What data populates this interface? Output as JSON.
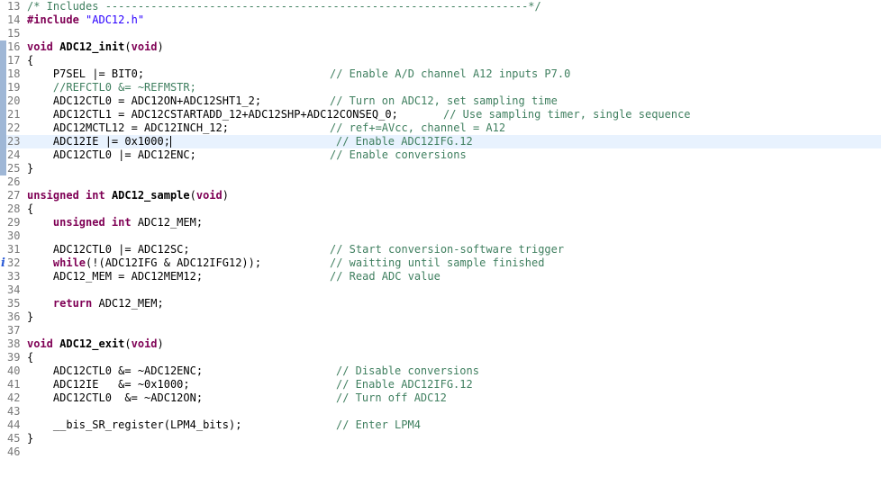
{
  "editor": {
    "current_line": "23",
    "lines": [
      {
        "num": "13",
        "c1": "/* Includes -----------------------------------------------------------------*/"
      },
      {
        "num": "14",
        "kw": "#include",
        "str": "\"ADC12.h\""
      },
      {
        "num": "15"
      },
      {
        "num": "16",
        "kw": "void",
        "fn": "ADC12_init",
        "open": "(",
        "kw2": "void",
        "close": ")"
      },
      {
        "num": "17",
        "text": "{"
      },
      {
        "num": "18",
        "code": "    P7SEL |= BIT0;",
        "comment": "// Enable A/D channel A12 inputs P7.0"
      },
      {
        "num": "19",
        "commentcode": "    //REFCTL0 &= ~REFMSTR;"
      },
      {
        "num": "20",
        "code": "    ADC12CTL0 = ADC12ON+ADC12SHT1_2;",
        "comment": "// Turn on ADC12, set sampling time"
      },
      {
        "num": "21",
        "code": "    ADC12CTL1 = ADC12CSTARTADD_12+ADC12SHP+ADC12CONSEQ_0;",
        "comment": "// Use sampling timer, single sequence"
      },
      {
        "num": "22",
        "code": "    ADC12MCTL12 = ADC12INCH_12;",
        "comment": "// ref+=AVcc, channel = A12"
      },
      {
        "num": "23",
        "code": "    ADC12IE |= 0x1000;",
        "comment": "// Enable ADC12IFG.12"
      },
      {
        "num": "24",
        "code": "    ADC12CTL0 |= ADC12ENC;",
        "comment": "// Enable conversions"
      },
      {
        "num": "25",
        "text": "}"
      },
      {
        "num": "26"
      },
      {
        "num": "27",
        "kw": "unsigned int",
        "fn": "ADC12_sample",
        "open": "(",
        "kw2": "void",
        "close": ")"
      },
      {
        "num": "28",
        "text": "{"
      },
      {
        "num": "29",
        "kw_indent": "    unsigned int",
        "rest": " ADC12_MEM;"
      },
      {
        "num": "30"
      },
      {
        "num": "31",
        "code": "    ADC12CTL0 |= ADC12SC;",
        "comment": "// Start conversion-software trigger"
      },
      {
        "num": "32",
        "kw_indent": "    while",
        "rest": "(!(ADC12IFG & ADC12IFG12));",
        "comment": "// waitting until sample finished"
      },
      {
        "num": "33",
        "code": "    ADC12_MEM = ADC12MEM12;",
        "comment": "// Read ADC value"
      },
      {
        "num": "34"
      },
      {
        "num": "35",
        "kw_indent": "    return",
        "rest": " ADC12_MEM;"
      },
      {
        "num": "36",
        "text": "}"
      },
      {
        "num": "37"
      },
      {
        "num": "38",
        "kw": "void",
        "fn": "ADC12_exit",
        "open": "(",
        "kw2": "void",
        "close": ")"
      },
      {
        "num": "39",
        "text": "{"
      },
      {
        "num": "40",
        "code": "    ADC12CTL0 &= ~ADC12ENC;",
        "comment": "// Disable conversions"
      },
      {
        "num": "41",
        "code": "    ADC12IE   &= ~0x1000;",
        "comment": "// Enable ADC12IFG.12"
      },
      {
        "num": "42",
        "code": "    ADC12CTL0  &= ~ADC12ON;",
        "comment": "// Turn off ADC12"
      },
      {
        "num": "43"
      },
      {
        "num": "44",
        "code": "    __bis_SR_register(LPM4_bits);",
        "comment": "// Enter LPM4"
      },
      {
        "num": "45",
        "text": "}"
      },
      {
        "num": "46"
      }
    ]
  },
  "colors": {
    "keyword": "#7f0055",
    "string": "#2a00ff",
    "comment": "#3f7f5f",
    "current_line": "#e8f2fe",
    "fold_marker": "#9fb7d6"
  },
  "icons": {
    "info_marker_line_32": "info-icon"
  }
}
